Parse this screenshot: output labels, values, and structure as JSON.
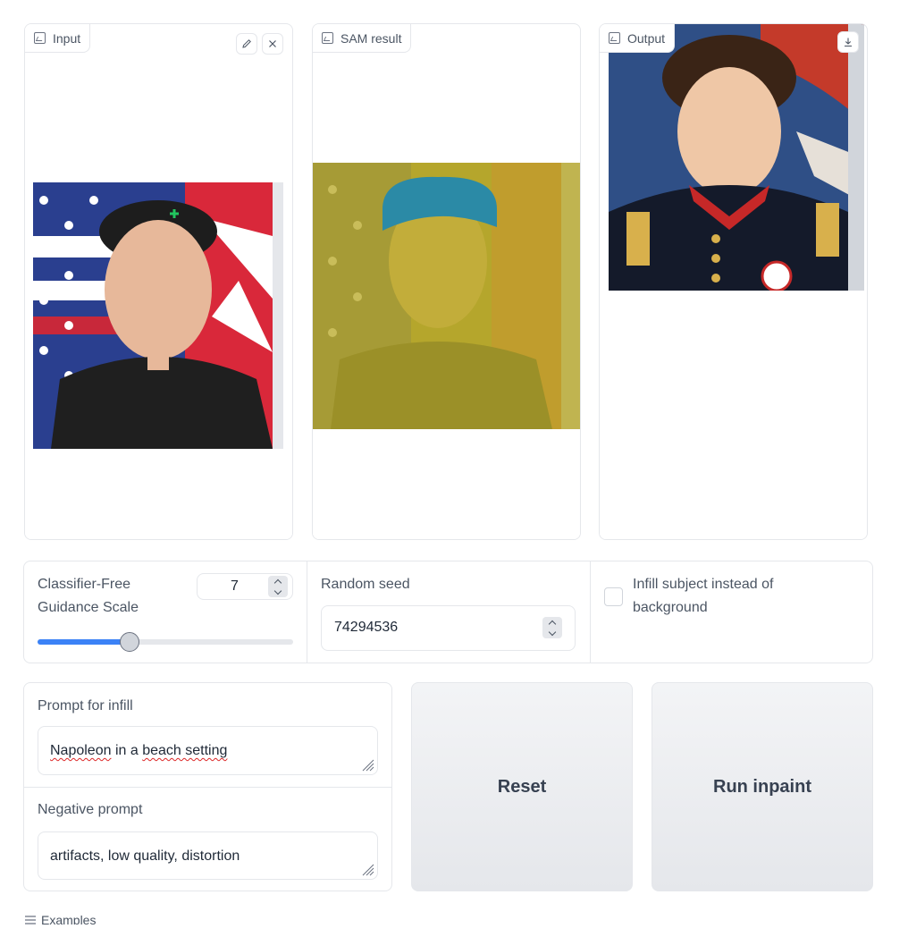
{
  "panels": {
    "input": {
      "label": "Input"
    },
    "sam": {
      "label": "SAM result"
    },
    "output": {
      "label": "Output"
    }
  },
  "controls": {
    "cfg": {
      "label": "Classifier-Free Guidance Scale",
      "value": "7",
      "slider_fraction": 0.36
    },
    "seed": {
      "label": "Random seed",
      "value": "74294536"
    },
    "invert": {
      "label": "Infill subject instead of background",
      "checked": false
    }
  },
  "prompts": {
    "infill": {
      "label": "Prompt for infill",
      "value_word1": "Napoleon",
      "value_mid": " in a ",
      "value_word2": "beach setting"
    },
    "negative": {
      "label": "Negative prompt",
      "value": "artifacts, low quality, distortion"
    }
  },
  "buttons": {
    "reset": "Reset",
    "run": "Run inpaint"
  },
  "examples": {
    "label": "Examples"
  },
  "colors": {
    "accent": "#3b82f6",
    "mask_overlay": "#b5a62c",
    "hair_mask": "#2b8aa6"
  }
}
